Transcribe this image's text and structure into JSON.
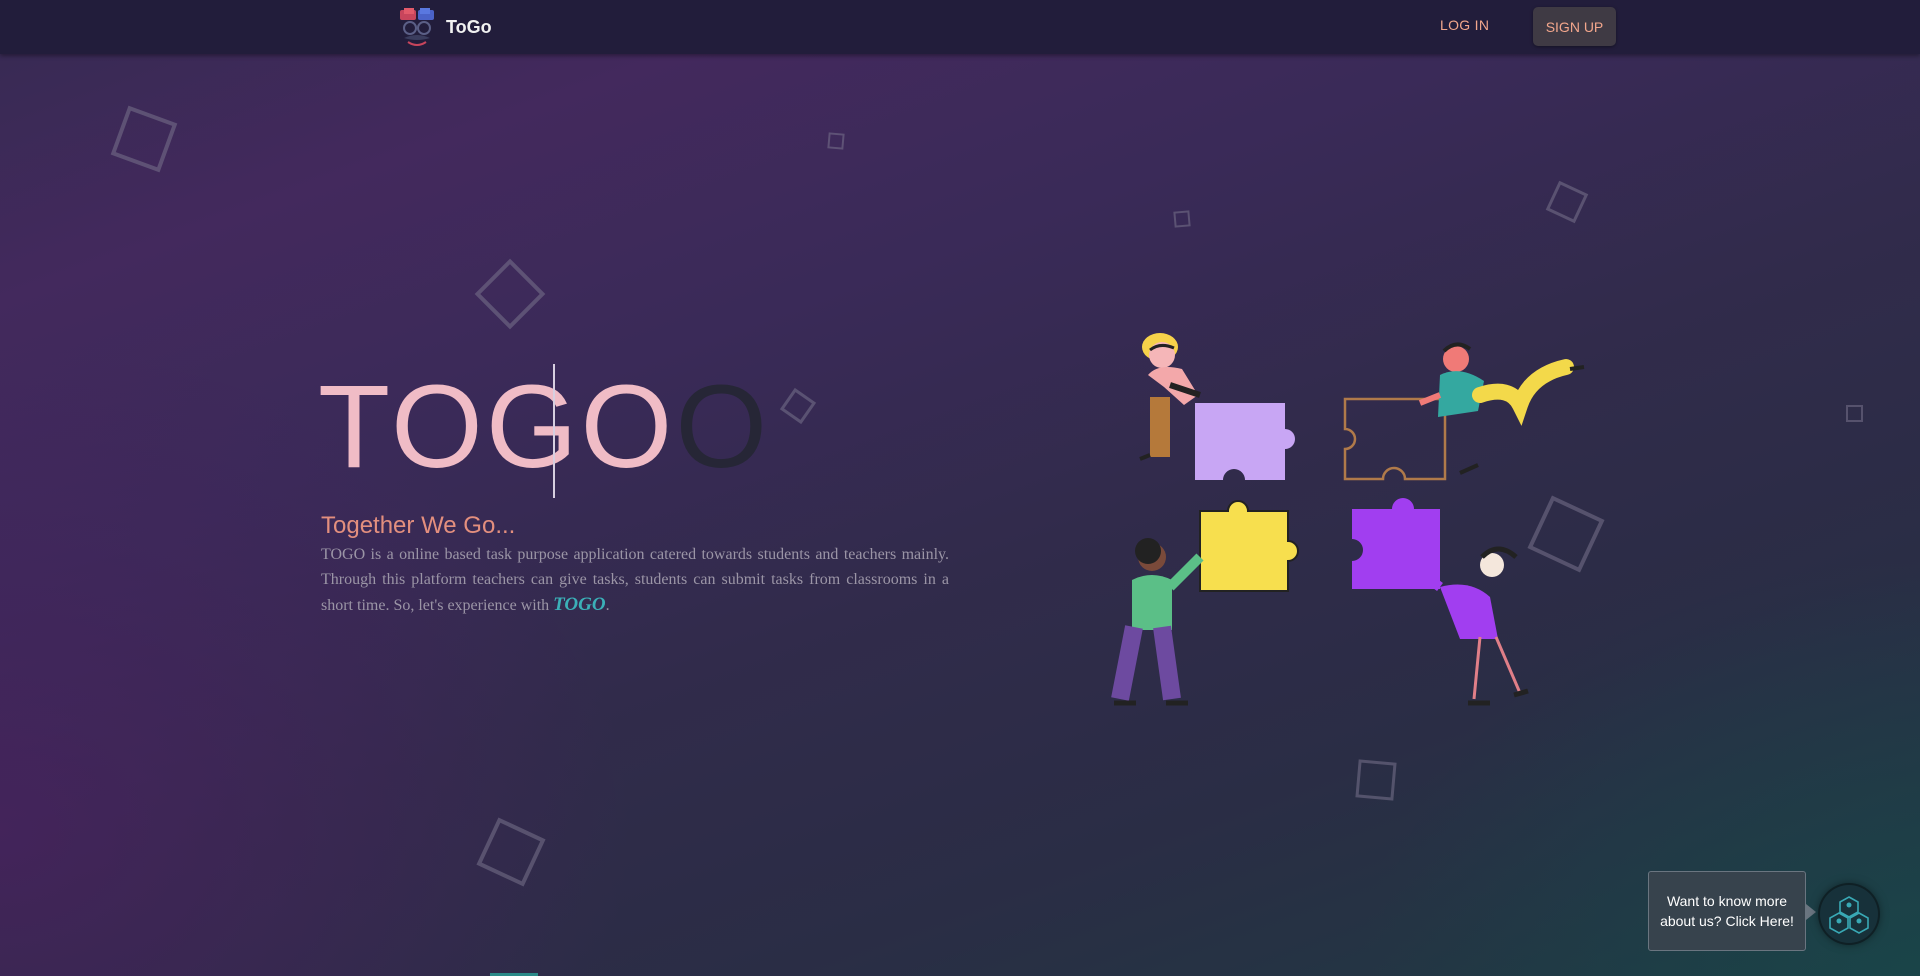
{
  "navbar": {
    "brand_name": "ToGo",
    "login_label": "LOG IN",
    "signup_label": "SIGN UP"
  },
  "hero": {
    "title_typed": "TOGO",
    "title_rest": "O",
    "tagline": "Together We Go...",
    "description": "TOGO is a online based task purpose application catered towards students and teachers mainly. Through this platform teachers can give tasks, students can submit tasks from classrooms in a short time. So, let's experience with ",
    "description_brand": "TOGO",
    "description_end": "."
  },
  "about": {
    "bubble_text": "Want to know more about us? Click Here!"
  },
  "illustration": {
    "icon": "puzzle-team-illustration"
  },
  "colors": {
    "accent_salmon": "#f2a68c",
    "title_pink": "#f0bcc6",
    "teal_brand": "#3bb0b8",
    "navbar_bg": "#221d3b"
  }
}
